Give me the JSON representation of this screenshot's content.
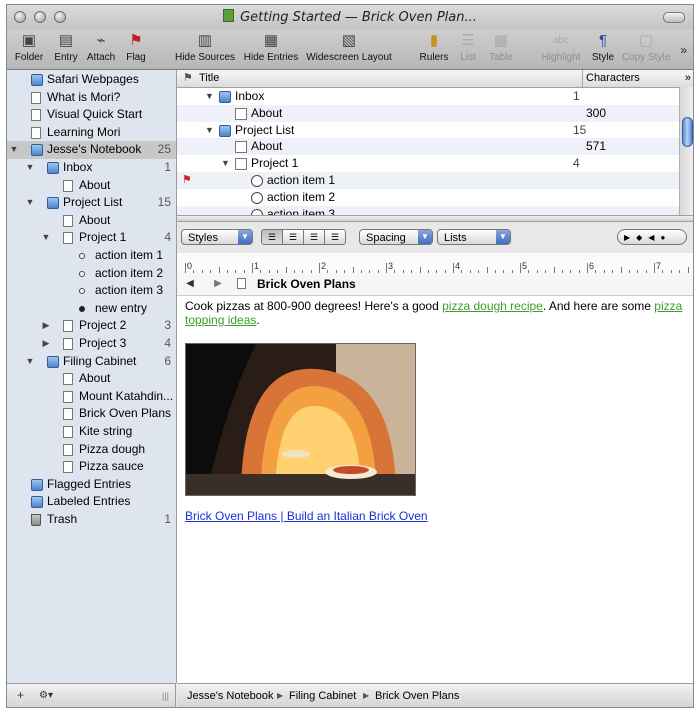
{
  "window": {
    "title": "Getting Started — Brick Oven Plan..."
  },
  "toolbar": {
    "items": [
      {
        "label": "Folder",
        "icon": "folder-add-icon"
      },
      {
        "label": "Entry",
        "icon": "entry-add-icon"
      },
      {
        "label": "Attach",
        "icon": "paperclip-icon"
      },
      {
        "label": "Flag",
        "icon": "flag-icon"
      },
      {
        "label": "Hide Sources",
        "icon": "hide-sources-icon"
      },
      {
        "label": "Hide Entries",
        "icon": "hide-entries-icon"
      },
      {
        "label": "Widescreen Layout",
        "icon": "widescreen-icon"
      },
      {
        "label": "Rulers",
        "icon": "rulers-icon"
      },
      {
        "label": "List",
        "icon": "list-icon"
      },
      {
        "label": "Table",
        "icon": "table-icon"
      },
      {
        "label": "Highlight",
        "icon": "highlight-icon"
      },
      {
        "label": "Style",
        "icon": "pilcrow-icon"
      },
      {
        "label": "Copy Style",
        "icon": "copy-style-icon"
      }
    ],
    "overflow": "»"
  },
  "sidebar": {
    "items": [
      {
        "label": "Safari Webpages",
        "count": "",
        "icon": "folder",
        "level": 0,
        "tri": ""
      },
      {
        "label": "What is Mori?",
        "count": "",
        "icon": "doc",
        "level": 0,
        "tri": ""
      },
      {
        "label": "Visual Quick Start",
        "count": "",
        "icon": "doc",
        "level": 0,
        "tri": ""
      },
      {
        "label": "Learning Mori",
        "count": "",
        "icon": "doc",
        "level": 0,
        "tri": ""
      },
      {
        "label": "Jesse's Notebook",
        "count": "25",
        "icon": "folder",
        "level": 0,
        "tri": "▼"
      },
      {
        "label": "Inbox",
        "count": "1",
        "icon": "folder",
        "level": 1,
        "tri": "▼"
      },
      {
        "label": "About",
        "count": "",
        "icon": "doc",
        "level": 2,
        "tri": ""
      },
      {
        "label": "Project List",
        "count": "15",
        "icon": "folder",
        "level": 1,
        "tri": "▼"
      },
      {
        "label": "About",
        "count": "",
        "icon": "doc",
        "level": 2,
        "tri": ""
      },
      {
        "label": "Project 1",
        "count": "4",
        "icon": "doc",
        "level": 2,
        "tri": "▼"
      },
      {
        "label": "action item 1",
        "count": "",
        "icon": "dot",
        "level": 3,
        "tri": ""
      },
      {
        "label": "action item 2",
        "count": "",
        "icon": "dot",
        "level": 3,
        "tri": ""
      },
      {
        "label": "action item 3",
        "count": "",
        "icon": "dot",
        "level": 3,
        "tri": ""
      },
      {
        "label": "new entry",
        "count": "",
        "icon": "dotfill",
        "level": 3,
        "tri": ""
      },
      {
        "label": "Project 2",
        "count": "3",
        "icon": "doc",
        "level": 2,
        "tri": "▶"
      },
      {
        "label": "Project 3",
        "count": "4",
        "icon": "doc",
        "level": 2,
        "tri": "▶"
      },
      {
        "label": "Filing Cabinet",
        "count": "6",
        "icon": "folder",
        "level": 1,
        "tri": "▼"
      },
      {
        "label": "About",
        "count": "",
        "icon": "doc",
        "level": 2,
        "tri": ""
      },
      {
        "label": "Mount Katahdin...",
        "count": "",
        "icon": "doc",
        "level": 2,
        "tri": ""
      },
      {
        "label": "Brick Oven Plans",
        "count": "",
        "icon": "doc",
        "level": 2,
        "tri": ""
      },
      {
        "label": "Kite string",
        "count": "",
        "icon": "doc",
        "level": 2,
        "tri": ""
      },
      {
        "label": "Pizza dough",
        "count": "",
        "icon": "doc",
        "level": 2,
        "tri": ""
      },
      {
        "label": "Pizza sauce",
        "count": "",
        "icon": "doc",
        "level": 2,
        "tri": ""
      },
      {
        "label": "Flagged Entries",
        "count": "",
        "icon": "folder",
        "level": 0,
        "tri": ""
      },
      {
        "label": "Labeled Entries",
        "count": "",
        "icon": "folder",
        "level": 0,
        "tri": ""
      },
      {
        "label": "Trash",
        "count": "1",
        "icon": "trash",
        "level": 0,
        "tri": ""
      }
    ],
    "bottom": {
      "add": "+",
      "gear": "⚙▾",
      "grip": "|||"
    }
  },
  "outline": {
    "columns": {
      "title": "Title",
      "characters": "Characters"
    },
    "rows": [
      {
        "label": "Inbox",
        "count": "1",
        "chars": "",
        "icon": "folder",
        "level": 0,
        "tri": "▼",
        "flag": false
      },
      {
        "label": "About",
        "count": "",
        "chars": "300",
        "icon": "doc",
        "level": 1,
        "tri": "",
        "flag": false
      },
      {
        "label": "Project List",
        "count": "15",
        "chars": "",
        "icon": "folder",
        "level": 0,
        "tri": "▼",
        "flag": false
      },
      {
        "label": "About",
        "count": "",
        "chars": "571",
        "icon": "doc",
        "level": 1,
        "tri": "",
        "flag": false
      },
      {
        "label": "Project 1",
        "count": "4",
        "chars": "",
        "icon": "doc",
        "level": 1,
        "tri": "▼",
        "flag": false
      },
      {
        "label": "action item 1",
        "count": "",
        "chars": "",
        "icon": "dot",
        "level": 2,
        "tri": "",
        "flag": true
      },
      {
        "label": "action item 2",
        "count": "",
        "chars": "",
        "icon": "dot",
        "level": 2,
        "tri": "",
        "flag": false
      },
      {
        "label": "action item 3",
        "count": "",
        "chars": "",
        "icon": "dot",
        "level": 2,
        "tri": "",
        "flag": false
      }
    ]
  },
  "format": {
    "styles": "Styles",
    "spacing": "Spacing",
    "lists": "Lists"
  },
  "ruler": {
    "numbers": [
      "0",
      "1",
      "2",
      "3",
      "4",
      "5",
      "6",
      "7"
    ]
  },
  "entry": {
    "title": "Brick Oven Plans",
    "text1": "Cook pizzas at 800-900 degrees! Here's a good ",
    "link1": "pizza dough recipe",
    "text2": ". And here are some ",
    "link2": "pizza topping ideas",
    "text3": ".",
    "bottom_link": "Brick Oven Plans | Build an Italian Brick Oven"
  },
  "pathbar": {
    "segments": [
      "Jesse's Notebook",
      "Filing Cabinet",
      "Brick Oven Plans"
    ]
  }
}
